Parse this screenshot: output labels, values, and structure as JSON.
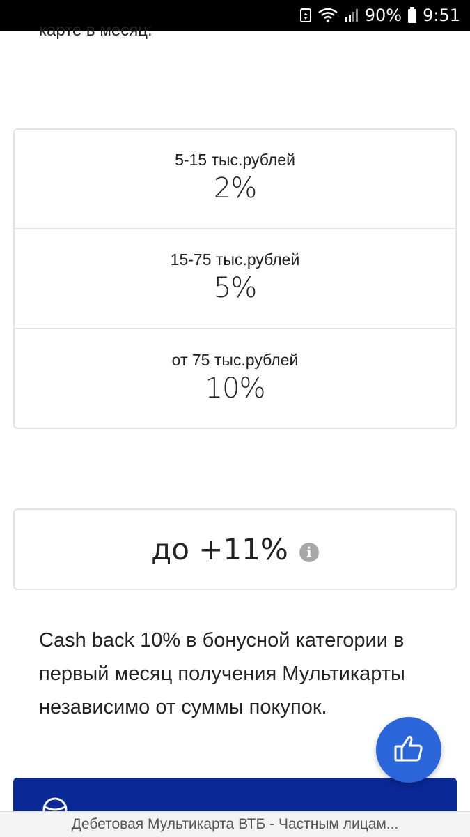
{
  "status_bar": {
    "battery_percent": "90%",
    "time": "9:51",
    "icons": [
      "data-saver-icon",
      "wifi-icon",
      "signal-icon",
      "battery-icon"
    ]
  },
  "intro_text": "карте в месяц:",
  "tiers": [
    {
      "range": "5-15 тыс.рублей",
      "percent": "2%"
    },
    {
      "range": "15-75 тыс.рублей",
      "percent": "5%"
    },
    {
      "range": "от 75 тыс.рублей",
      "percent": "10%"
    }
  ],
  "max_cashback": {
    "value": "до +11%",
    "info_icon": "info-icon"
  },
  "cashback_description": "Cash back 10% в бонусной категории в первый месяц получения Мультикарты независимо от суммы покупок.",
  "like_button": {
    "icon": "thumbs-up-icon"
  },
  "page_title": "Дебетовая Мультикарта ВТБ - Частным лицам...",
  "colors": {
    "panel_blue": "#0a2896",
    "fab_blue": "#2a66d9",
    "border": "#e3e3e3"
  }
}
